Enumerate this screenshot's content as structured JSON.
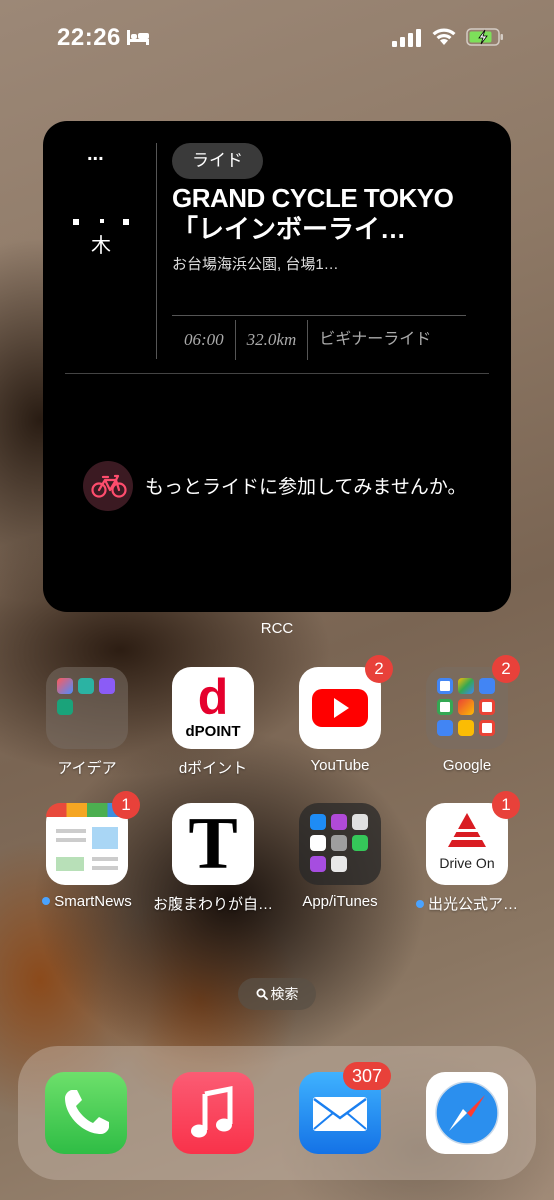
{
  "status_bar": {
    "time": "22:26"
  },
  "widget": {
    "more": "...",
    "day": "木",
    "tag": "ライド",
    "title_line1": "GRAND CYCLE TOKYO",
    "title_line2": "「レインボーライ…",
    "location": "お台場海浜公園, 台場1…",
    "stats": [
      "06:00",
      "32.0km",
      "ビギナーライド"
    ],
    "cta": "もっとライドに参加してみませんか。",
    "label": "RCC"
  },
  "apps": [
    {
      "label": "アイデア",
      "badge": ""
    },
    {
      "label": "dポイント",
      "badge": ""
    },
    {
      "label": "YouTube",
      "badge": "2"
    },
    {
      "label": "Google",
      "badge": "2"
    },
    {
      "label": "SmartNews",
      "badge": "1"
    },
    {
      "label": "お腹まわりが自…",
      "badge": ""
    },
    {
      "label": "App/iTunes",
      "badge": ""
    },
    {
      "label": "出光公式ア…",
      "badge": "1"
    }
  ],
  "icon_text": {
    "dpoint_big": "d",
    "dpoint_small": "dPOINT",
    "t_letter": "T",
    "drive_on": "Drive On"
  },
  "search": {
    "label": "検索"
  },
  "dock": {
    "mail_badge": "307"
  },
  "colors": {
    "badge": "#e8413a",
    "youtube_red": "#ff0000",
    "dpoint_red": "#e5002d",
    "phone_green": "#35c759",
    "music_red": "#fa3e55",
    "mail_blue": "#1e8cf5"
  }
}
